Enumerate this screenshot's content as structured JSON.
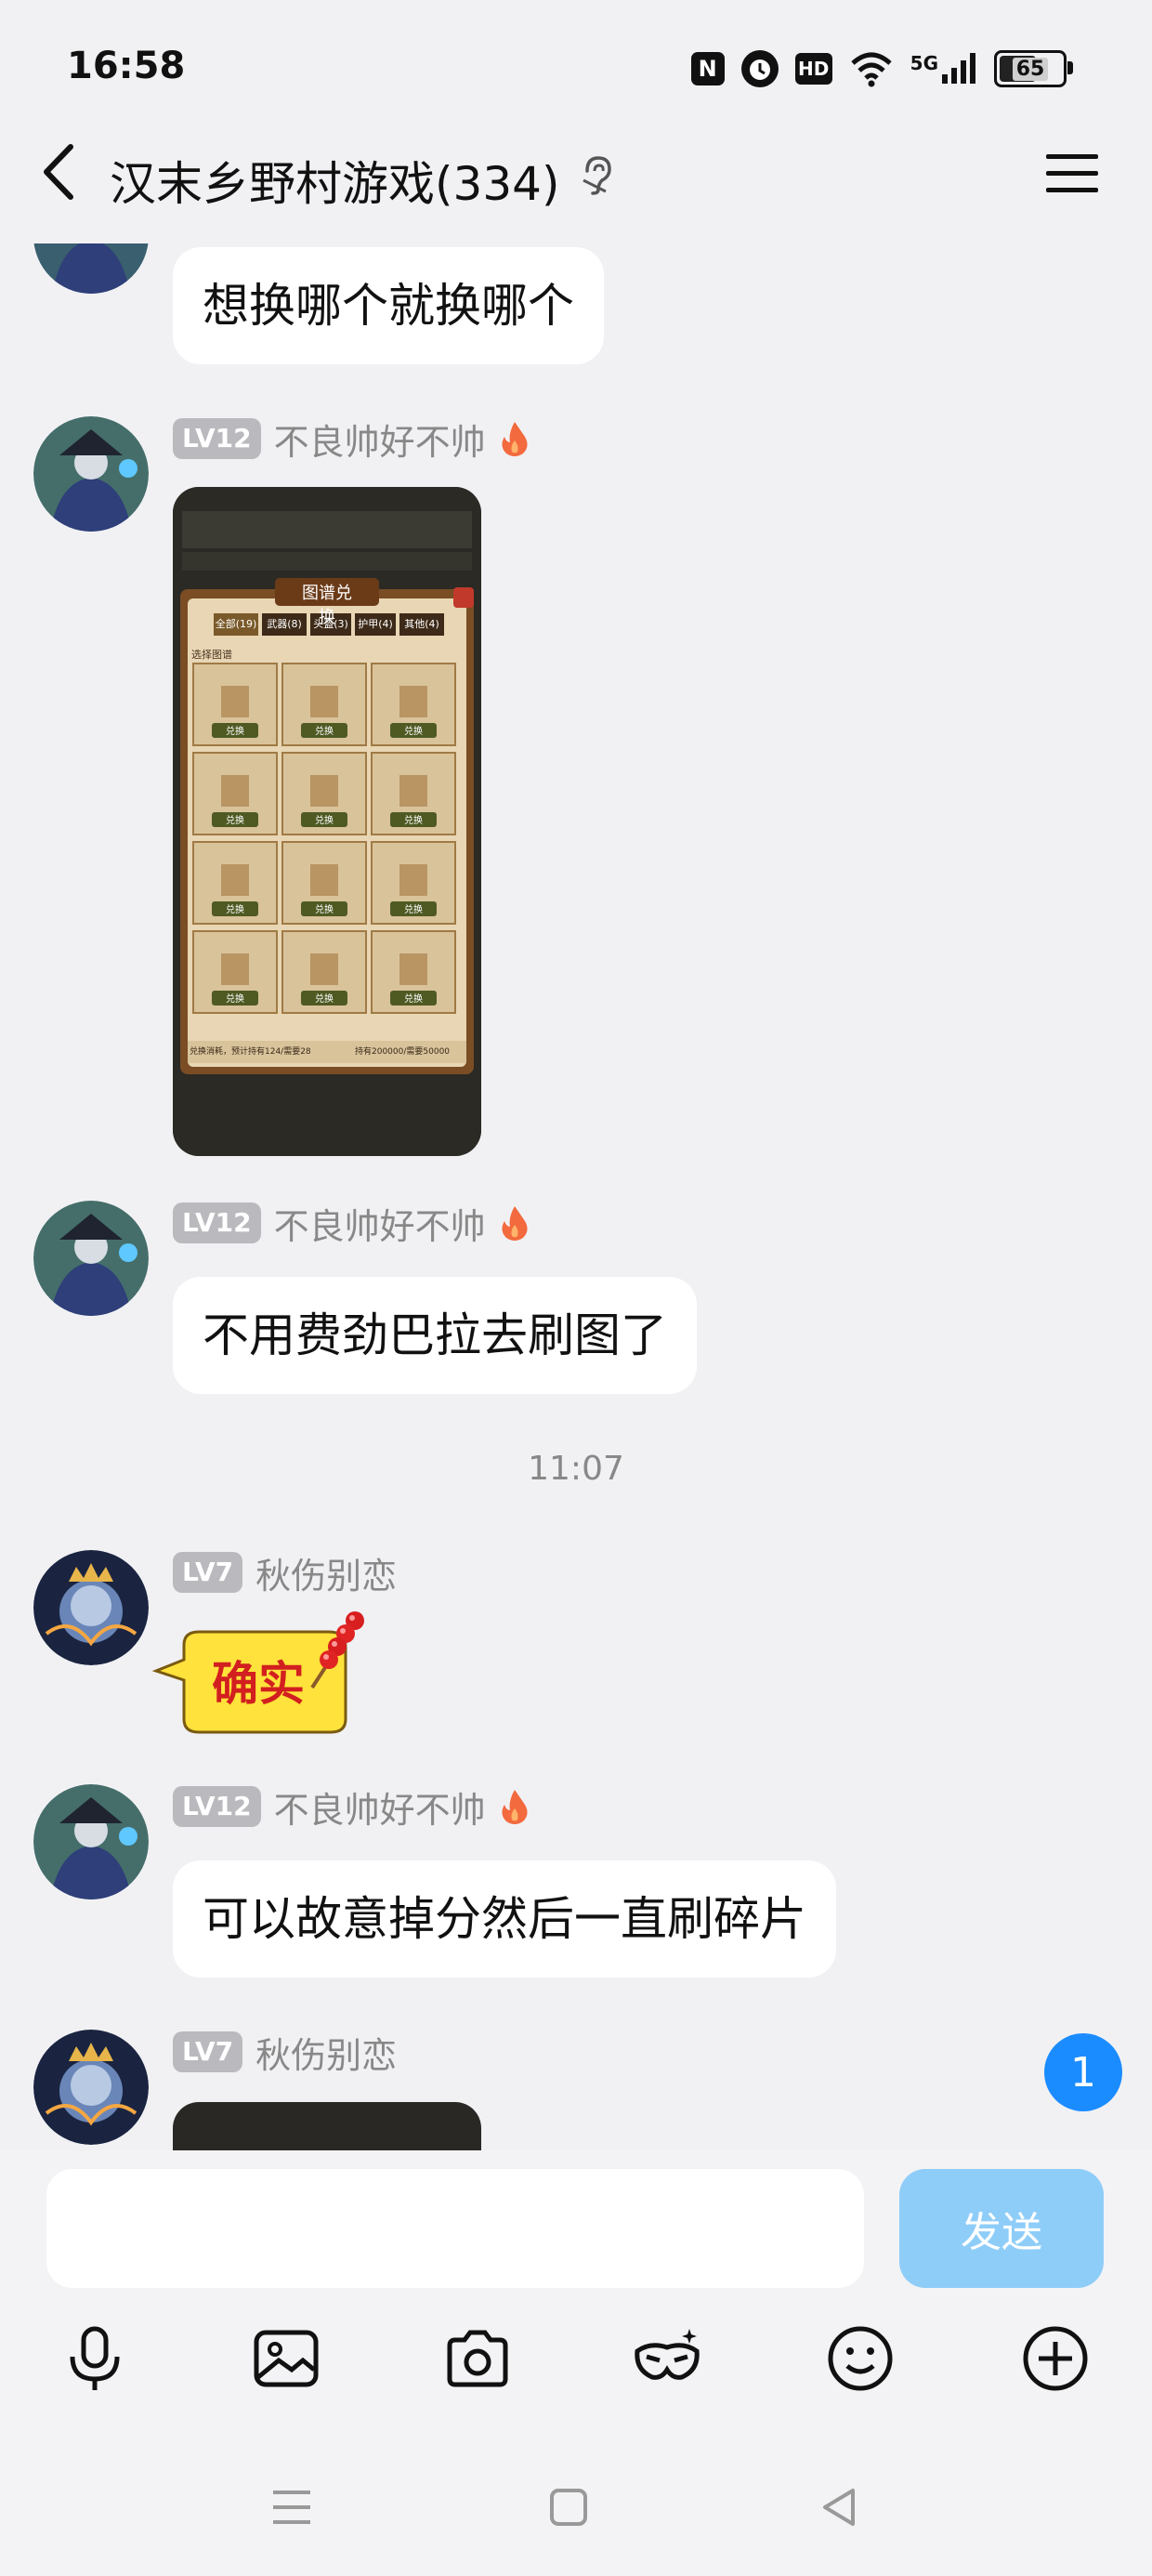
{
  "status_bar": {
    "time": "16:58",
    "icons": [
      "nfc-icon",
      "alarm-icon",
      "hd-icon",
      "wifi-icon",
      "5g-signal-icon",
      "battery-icon"
    ],
    "network": "5G",
    "battery_level": "65"
  },
  "header": {
    "title": "汉末乡野村游戏(334)",
    "back_icon": "chevron-left-icon",
    "ear_icon": "ear-icon",
    "menu_icon": "menu-icon"
  },
  "colors": {
    "background": "#f1f1f4",
    "bubble": "#ffffff",
    "level_badge": "#b9b9be",
    "unread_badge": "#1a8cff",
    "send_button": "#8fcdf9"
  },
  "messages": [
    {
      "type": "text",
      "text": "想换哪个就换哪个"
    },
    {
      "type": "image",
      "level": "LV12",
      "name": "不良帅好不帅",
      "badge_icon": "flame-icon",
      "image": {
        "dialog_title": "图谱兑换",
        "tabs": [
          "全部(19)",
          "武器(8)",
          "头盔(3)",
          "护甲(4)",
          "其他(4)"
        ],
        "section": "选择图谱",
        "button_label": "兑换",
        "footer_left": "兑换消耗，预计持有124/需要28",
        "footer_right": "持有200000/需要50000"
      }
    },
    {
      "type": "text",
      "level": "LV12",
      "name": "不良帅好不帅",
      "badge_icon": "flame-icon",
      "text": "不用费劲巴拉去刷图了"
    },
    {
      "type": "timestamp",
      "text": "11:07"
    },
    {
      "type": "sticker",
      "level": "LV7",
      "name": "秋伤别恋",
      "text": "确实",
      "sticker_icon": "candied-haws-icon"
    },
    {
      "type": "text",
      "level": "LV12",
      "name": "不良帅好不帅",
      "badge_icon": "flame-icon",
      "text": "可以故意掉分然后一直刷碎片"
    },
    {
      "type": "image",
      "level": "LV7",
      "name": "秋伤别恋"
    }
  ],
  "unread_badge": "1",
  "input": {
    "placeholder": "",
    "send_label": "发送"
  },
  "toolbar": [
    "microphone-icon",
    "picture-icon",
    "camera-icon",
    "mask-icon",
    "smiley-icon",
    "plus-circle-icon"
  ],
  "navbar": [
    "recent-apps-icon",
    "home-icon",
    "back-triangle-icon"
  ]
}
